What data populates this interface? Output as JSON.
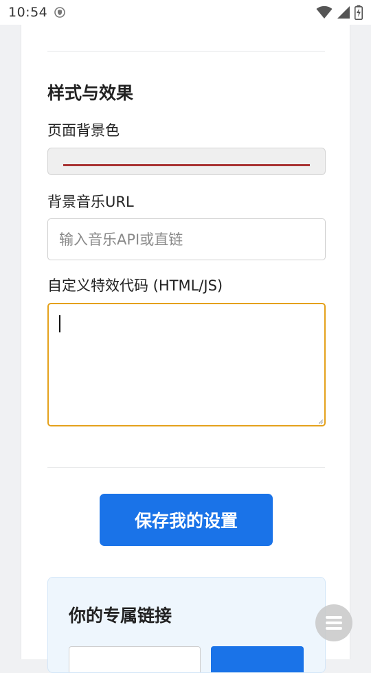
{
  "status_bar": {
    "time": "10:54",
    "icons": [
      "shield-icon",
      "wifi-icon",
      "signal-icon",
      "battery-charging-icon"
    ]
  },
  "section": {
    "title": "样式与效果"
  },
  "fields": {
    "bg_color_label": "页面背景色",
    "bg_color_value": "#a83333",
    "music_label": "背景音乐URL",
    "music_placeholder": "输入音乐API或直链",
    "music_value": "",
    "code_label": "自定义特效代码 (HTML/JS)",
    "code_value": ""
  },
  "actions": {
    "save_label": "保存我的设置"
  },
  "link_panel": {
    "title": "你的专属链接"
  },
  "colors": {
    "primary": "#1a73e8",
    "focus_border": "#e4a11b",
    "link_panel_bg": "#eef6fd"
  },
  "fab": {
    "icon": "menu-icon"
  }
}
